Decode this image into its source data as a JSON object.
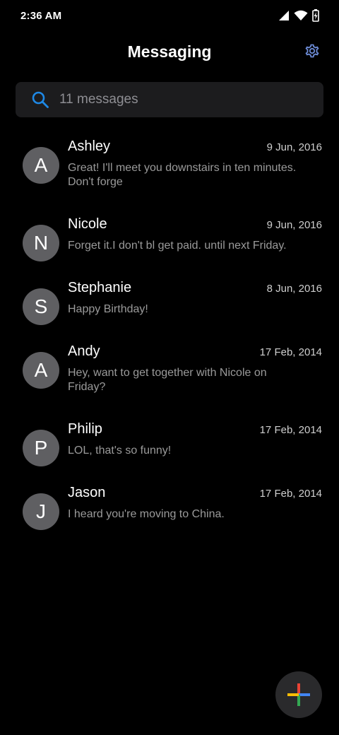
{
  "status_bar": {
    "time": "2:36 AM",
    "icons": [
      "signal-icon",
      "wifi-icon",
      "battery-charging-icon"
    ]
  },
  "header": {
    "title": "Messaging",
    "settings_icon": "gear-icon",
    "accent_color": "#6c8bd6"
  },
  "search": {
    "placeholder": "11 messages",
    "icon": "search-icon",
    "icon_color": "#1e88e5"
  },
  "conversations": [
    {
      "initial": "A",
      "name": "Ashley",
      "date": "9 Jun, 2016",
      "snippet": "Great! I'll meet you downstairs in ten minutes. Don't forge"
    },
    {
      "initial": "N",
      "name": "Nicole",
      "date": "9 Jun, 2016",
      "snippet": "Forget it.I don't bl get paid. until next Friday."
    },
    {
      "initial": "S",
      "name": "Stephanie",
      "date": "8 Jun, 2016",
      "snippet": "Happy Birthday!"
    },
    {
      "initial": "A",
      "name": "Andy",
      "date": "17 Feb, 2014",
      "snippet": "Hey, want to get together with Nicole on Friday?"
    },
    {
      "initial": "P",
      "name": "Philip",
      "date": "17 Feb, 2014",
      "snippet": "LOL, that's so funny!"
    },
    {
      "initial": "J",
      "name": "Jason",
      "date": "17 Feb, 2014",
      "snippet": "I heard you're moving to China."
    }
  ],
  "fab": {
    "icon": "plus-icon",
    "colors": [
      "#4285f4",
      "#ea4335",
      "#fbbc05",
      "#34a853"
    ]
  }
}
